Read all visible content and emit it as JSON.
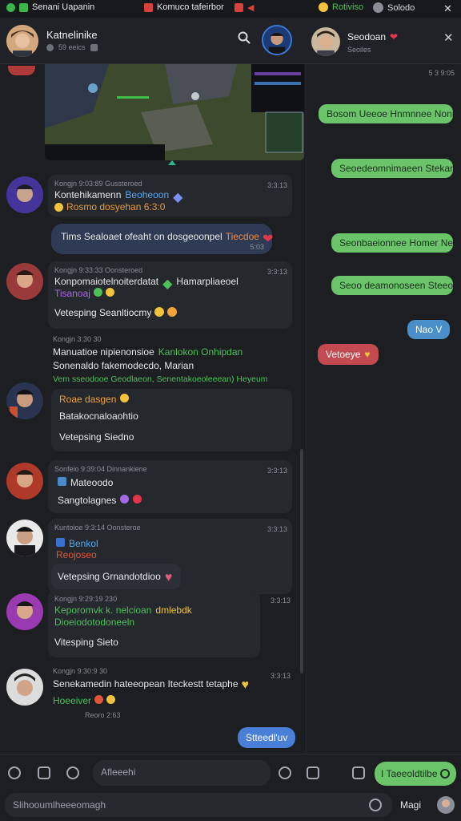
{
  "topbar": {
    "app_title": "Senani Uapanin",
    "tab_title": "Komuco tafeirbor",
    "status_label": "Rotiviso",
    "profile_label": "Solodo",
    "close_glyph": "✕",
    "colors": {
      "accent": "#3bb54a",
      "tab": "#d9423a"
    }
  },
  "header": {
    "chat_name": "Katnelinike",
    "chat_sub": "59 eeics",
    "right_name": "Seodoan",
    "right_sub": "Seoiles",
    "close_glyph": "✕"
  },
  "messages": [
    {
      "meta": "Kongjn 9:03:89 Gussteroed",
      "time": "3:3:13",
      "line1": "Kontehikamenn",
      "tag": "Beoheoon",
      "line2": "Rosmo dosyehan 6:3:0"
    },
    {
      "meta": "",
      "time": "",
      "line1": "Tims Sealoaet ofeaht on dosgeoonpel",
      "tag": "Tiecdoe",
      "line2": "5:03"
    },
    {
      "meta": "Kongjn 9:33:33 Oonsteroed",
      "time": "3:3:13",
      "line1": "Konpomaiotelnoiterdatat",
      "tag": "Hamarpliaeoel",
      "line2": "Tisanoaj",
      "line3": "Vetesping Seanltiocmy"
    },
    {
      "meta": "Kongjn 3:30 30",
      "time": "",
      "line1": "Manuatioe nipienonsioe",
      "tag": "Kanlokon Onhipdan",
      "line2": "Sonenaldo fakemodecdo, Marian",
      "line3": "Vem sseodooe Geodlaeon, Senentakoeoleeean) Heyeum"
    },
    {
      "meta": "",
      "time": "",
      "line1": "Roae dasgen",
      "line2": "Batakocnaloaohtio",
      "line3": "Vetepsing Siedno"
    },
    {
      "meta": "Sonfeio 9:39:04 Dinnankiene",
      "time": "3:3:13",
      "line1": "Mateoodo",
      "line2": "Sangtolagnes"
    },
    {
      "meta": "Kuntoioe 9:3:14 Oonsteroe",
      "time": "3:3:13",
      "line1": "Benkol",
      "line2": "Reojoseo",
      "line3": "Vetepsing Grnandotdioo"
    },
    {
      "meta": "Kongjn 9:29:19 230",
      "time": "3:3:13",
      "line1": "Keporomvk k. nelcioan",
      "tag": "dmlebdk",
      "line2": "Dioeiodotodoneeln",
      "line3": "Vitesping Sieto"
    },
    {
      "meta": "Kongjn 9:30:9 30",
      "time": "3:3:13",
      "line1": "Senekamedin hateeopean Iteckestt tetaphe",
      "line2": "Hoeeiver",
      "line3": "Reoro 2:63"
    }
  ],
  "own_reply": "Stteedl'uv",
  "right_messages": {
    "top_meta": "5 3 9:05",
    "bubbles": [
      "Bosom Ueeoe Hnmnnee Nonnidee",
      "Seoedeomnimaeen Stekanenl",
      "Seonbaeionnee Homer Nevseeber",
      "Seoo deamonoseen Steeotoon"
    ],
    "blue": "Nao V",
    "red": "Vetoeye"
  },
  "bottom": {
    "input_placeholder": "Afleeehi",
    "send_label": "I Taeeoldtilbe",
    "compose_placeholder": "Slihooumlheeeomagh",
    "right_label": "Magi"
  }
}
